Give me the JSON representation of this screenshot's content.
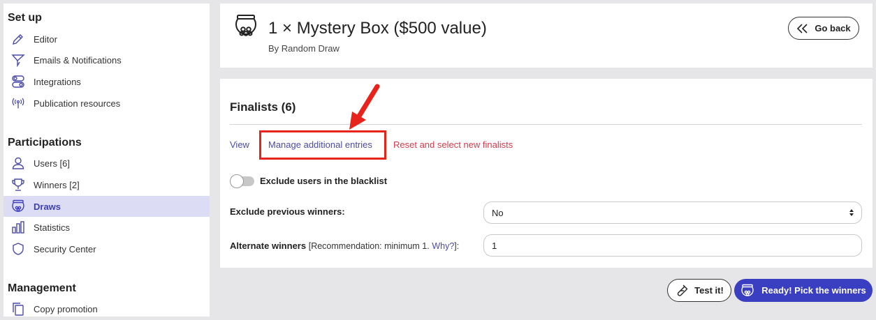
{
  "sidebar": {
    "setup_title": "Set up",
    "setup_items": [
      {
        "label": "Editor",
        "icon": "pencil-icon"
      },
      {
        "label": "Emails & Notifications",
        "icon": "send-icon"
      },
      {
        "label": "Integrations",
        "icon": "toggles-icon"
      },
      {
        "label": "Publication resources",
        "icon": "broadcast-icon"
      }
    ],
    "participations_title": "Participations",
    "participation_items": [
      {
        "label": "Users [6]",
        "icon": "user-icon"
      },
      {
        "label": "Winners [2]",
        "icon": "trophy-icon"
      },
      {
        "label": "Draws",
        "icon": "draw-bowl-icon",
        "active": true
      },
      {
        "label": "Statistics",
        "icon": "bar-chart-icon"
      },
      {
        "label": "Security Center",
        "icon": "shield-icon"
      }
    ],
    "management_title": "Management",
    "management_items": [
      {
        "label": "Copy promotion",
        "icon": "copy-icon"
      }
    ]
  },
  "header": {
    "title": "1 × Mystery Box ($500 value)",
    "subtitle": "By Random Draw",
    "go_back_label": "Go back"
  },
  "finalists": {
    "title": "Finalists (6)",
    "links": {
      "view": "View",
      "manage": "Manage additional entries",
      "reset": "Reset and select new finalists"
    },
    "blacklist_label": "Exclude users in the blacklist",
    "blacklist_enabled": false,
    "exclude_prev_label": "Exclude previous winners:",
    "exclude_prev_value": "No",
    "alternate_label": "Alternate winners",
    "alternate_note_pre": "[Recommendation: minimum 1.",
    "alternate_note_link": "Why?",
    "alternate_note_post": "]:",
    "alternate_value": "1"
  },
  "actions": {
    "test_label": "Test it!",
    "pick_label": "Ready! Pick the winners"
  },
  "colors": {
    "accent": "#3a3ec0",
    "link": "#4a4aa8",
    "danger": "#d83a4a",
    "annotation": "#e8231c",
    "active_bg": "#dcdcf4"
  }
}
